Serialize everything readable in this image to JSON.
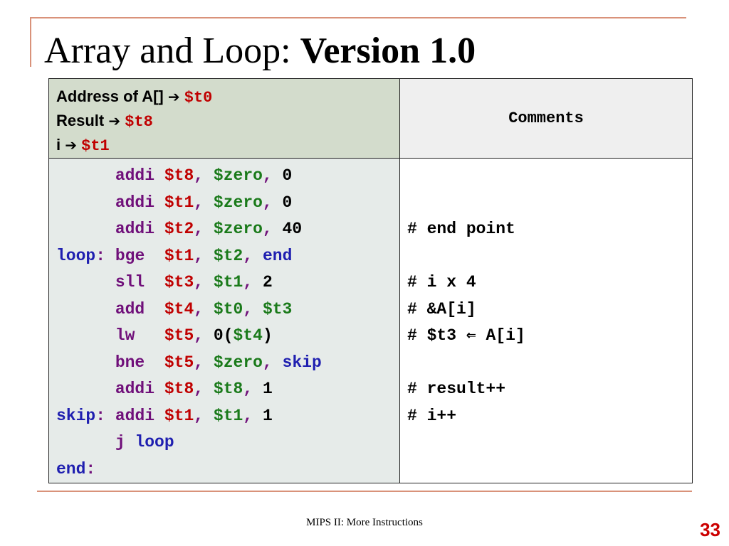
{
  "title": {
    "normal": "Array and Loop: ",
    "bold": "Version 1.0"
  },
  "header": {
    "line1": {
      "label": "Address of A[] ",
      "arrow": "➔",
      "reg": "$t0"
    },
    "line2": {
      "label": "Result ",
      "arrow": "➔",
      "reg": "$t8"
    },
    "line3": {
      "label": "i ",
      "arrow": "➔",
      "reg": "$t1"
    },
    "comments_label": "Comments"
  },
  "code": [
    {
      "label": "",
      "op": "addi",
      "args": [
        "$t8",
        "$zero",
        "0"
      ],
      "comment": ""
    },
    {
      "label": "",
      "op": "addi",
      "args": [
        "$t1",
        "$zero",
        "0"
      ],
      "comment": ""
    },
    {
      "label": "",
      "op": "addi",
      "args": [
        "$t2",
        "$zero",
        "40"
      ],
      "comment": "# end point"
    },
    {
      "label": "loop:",
      "op": "bge",
      "args": [
        "$t1",
        "$t2",
        "end"
      ],
      "comment": ""
    },
    {
      "label": "",
      "op": "sll",
      "args": [
        "$t3",
        "$t1",
        "2"
      ],
      "comment": "# i x 4"
    },
    {
      "label": "",
      "op": "add",
      "args": [
        "$t4",
        "$t0",
        "$t3"
      ],
      "comment": "# &A[i]"
    },
    {
      "label": "",
      "op": "lw",
      "args": [
        "$t5",
        "0(",
        "$t4",
        ")"
      ],
      "comment": "# $t3 ⇐ A[i]"
    },
    {
      "label": "",
      "op": "bne",
      "args": [
        "$t5",
        "$zero",
        "skip"
      ],
      "comment": ""
    },
    {
      "label": "",
      "op": "addi",
      "args": [
        "$t8",
        "$t8",
        "1"
      ],
      "comment": "# result++"
    },
    {
      "label": "skip:",
      "op": "addi",
      "args": [
        "$t1",
        "$t1",
        "1"
      ],
      "comment": "# i++"
    },
    {
      "label": "",
      "op": "j",
      "args": [
        "loop"
      ],
      "comment": ""
    },
    {
      "label": "end:",
      "op": "",
      "args": [],
      "comment": ""
    }
  ],
  "footer": "MIPS II: More Instructions",
  "page_number": "33",
  "colors": {
    "register": "#c00000",
    "zero_reg": "#1a7a1a",
    "label": "#1f1fb0",
    "opcode": "#70107a",
    "accent_line": "#d9927a"
  }
}
